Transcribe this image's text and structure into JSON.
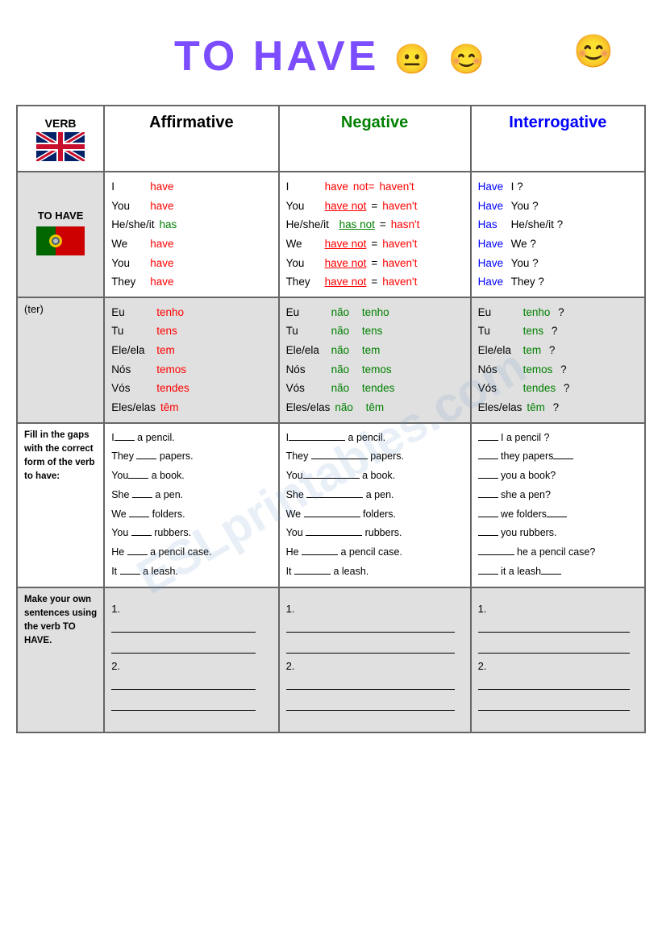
{
  "title": "TO HAVE",
  "sections": {
    "header": {
      "verb_label": "VERB",
      "affirmative": "Affirmative",
      "negative": "Negative",
      "interrogative": "Interrogative"
    },
    "english": {
      "label": "TO HAVE",
      "affirmative": [
        {
          "subject": "I",
          "verb": "have"
        },
        {
          "subject": "You",
          "verb": "have"
        },
        {
          "subject": "He/she/it",
          "verb": "has"
        },
        {
          "subject": "We",
          "verb": "have"
        },
        {
          "subject": "You",
          "verb": "have"
        },
        {
          "subject": "They",
          "verb": "have"
        }
      ],
      "negative": [
        {
          "subject": "I",
          "verb": "have",
          "not": "not=",
          "contracted": "haven't"
        },
        {
          "subject": "You",
          "verb": "have not",
          "equals": "=",
          "contracted": "haven't"
        },
        {
          "subject": "He/she/it",
          "verb": "has not",
          "equals": "=",
          "contracted": "hasn't"
        },
        {
          "subject": "We",
          "verb": "have not",
          "equals": "=",
          "contracted": "haven't"
        },
        {
          "subject": "You",
          "verb": "have not",
          "equals": "=",
          "contracted": "haven't"
        },
        {
          "subject": "They",
          "verb": "have  not",
          "equals": "=",
          "contracted": "haven't"
        }
      ],
      "interrogative": [
        {
          "aux": "Have",
          "subject": "I",
          "q": "?"
        },
        {
          "aux": "Have",
          "subject": "You",
          "q": "?"
        },
        {
          "aux": "Has",
          "subject": "He/she/it",
          "q": "?"
        },
        {
          "aux": "Have",
          "subject": "We",
          "q": "?"
        },
        {
          "aux": "Have",
          "subject": "You",
          "q": "?"
        },
        {
          "aux": "Have",
          "subject": "They",
          "q": "?"
        }
      ]
    },
    "portuguese": {
      "label": "(ter)",
      "affirmative": [
        {
          "subject": "Eu",
          "verb": "tenho"
        },
        {
          "subject": "Tu",
          "verb": "tens"
        },
        {
          "subject": "Ele/ela",
          "verb": "tem"
        },
        {
          "subject": "Nós",
          "verb": "temos"
        },
        {
          "subject": "Vós",
          "verb": "tendes"
        },
        {
          "subject": "Eles/elas",
          "verb": "têm"
        }
      ],
      "negative": [
        {
          "subject": "Eu",
          "neg": "não",
          "verb": "tenho"
        },
        {
          "subject": "Tu",
          "neg": "não",
          "verb": "tens"
        },
        {
          "subject": "Ele/ela",
          "neg": "não",
          "verb": "tem"
        },
        {
          "subject": "Nós",
          "neg": "não",
          "verb": "temos"
        },
        {
          "subject": "Vós",
          "neg": "não",
          "verb": "tendes"
        },
        {
          "subject": "Eles/elas",
          "neg": "não",
          "verb": "têm"
        }
      ],
      "interrogative": [
        {
          "subject": "Eu",
          "verb": "tenho",
          "q": "?"
        },
        {
          "subject": "Tu",
          "verb": "tens",
          "q": "?"
        },
        {
          "subject": "Ele/ela",
          "verb": "tem",
          "q": "?"
        },
        {
          "subject": "Nós",
          "verb": "temos",
          "q": "?"
        },
        {
          "subject": "Vós",
          "verb": "tendes",
          "q": "?"
        },
        {
          "subject": "Eles/elas",
          "verb": "têm",
          "q": "?"
        }
      ]
    },
    "fill_gaps": {
      "instruction": "Fill in the gaps with the correct form of the verb to have:",
      "affirmative": [
        "I___ a pencil.",
        "They ____ papers.",
        "You____ a book.",
        "She ___ a pen.",
        "We ____ folders.",
        "You ____ rubbers.",
        "He ___ a pencil case.",
        "It ___ a leash."
      ],
      "negative": [
        "I_______ a pencil.",
        "They ________ papers.",
        "You_________ a book.",
        "She _________ a pen.",
        "We _________ folders.",
        "You _________ rubbers.",
        "He ________ a pencil case.",
        "It _______ a leash."
      ],
      "interrogative": [
        "___ I a pencil ?",
        "____ they papers__",
        "____ you a book?",
        "____ she a pen?",
        "____ we folders__",
        "____ you rubbers.",
        "_____ he  a pencil case?",
        "___ it a leash__"
      ]
    },
    "make_sentences": {
      "instruction": "Make your own sentences using the verb TO HAVE.",
      "numbers": [
        "1.",
        "2."
      ]
    }
  }
}
